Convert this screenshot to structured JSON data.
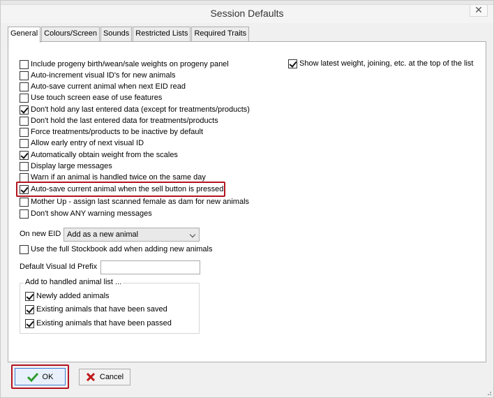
{
  "window": {
    "title": "Session Defaults",
    "close_glyph": "✕"
  },
  "tabs": [
    {
      "label": "General",
      "active": true
    },
    {
      "label": "Colours/Screen",
      "active": false
    },
    {
      "label": "Sounds",
      "active": false
    },
    {
      "label": "Restricted Lists",
      "active": false
    },
    {
      "label": "Required Traits",
      "active": false
    }
  ],
  "options_left": [
    {
      "label": "Include progeny birth/wean/sale weights on progeny panel",
      "checked": false
    },
    {
      "label": "Auto-increment visual ID's for new animals",
      "checked": false
    },
    {
      "label": "Auto-save current animal when next EID read",
      "checked": false
    },
    {
      "label": "Use touch screen ease of use features",
      "checked": false
    },
    {
      "label": "Don't hold any last entered data (except for treatments/products)",
      "checked": true
    },
    {
      "label": "Don't hold the last entered data for treatments/products",
      "checked": false
    },
    {
      "label": "Force treatments/products to be inactive by default",
      "checked": false
    },
    {
      "label": "Allow early entry of next visual ID",
      "checked": false
    },
    {
      "label": "Automatically obtain weight from the scales",
      "checked": true
    },
    {
      "label": "Display large messages",
      "checked": false
    },
    {
      "label": "Warn if an animal is handled twice on the same day",
      "checked": false
    },
    {
      "label": "Auto-save current animal when the sell button is pressed",
      "checked": true
    },
    {
      "label": "Mother Up - assign last scanned female as dam for new animals",
      "checked": false
    },
    {
      "label": "Don't show ANY warning messages",
      "checked": false
    }
  ],
  "options_right": [
    {
      "label": "Show latest weight, joining, etc. at the top of the list",
      "checked": true
    }
  ],
  "on_new_eid": {
    "label": "On new EID",
    "selected": "Add as a new animal"
  },
  "full_stockbook": {
    "label": "Use the full Stockbook add when adding new animals",
    "checked": false
  },
  "visual_id_prefix": {
    "label": "Default Visual Id Prefix",
    "value": ""
  },
  "handled_list": {
    "title": "Add to handled animal list ...",
    "items": [
      {
        "label": "Newly added animals",
        "checked": true
      },
      {
        "label": "Existing animals that have been saved",
        "checked": true
      },
      {
        "label": "Existing animals that have been passed",
        "checked": true
      }
    ]
  },
  "buttons": {
    "ok_label": "OK",
    "cancel_label": "Cancel"
  },
  "colors": {
    "highlight": "#b3141f",
    "ok_icon": "#2e9b2e",
    "cancel_icon": "#c01818"
  }
}
